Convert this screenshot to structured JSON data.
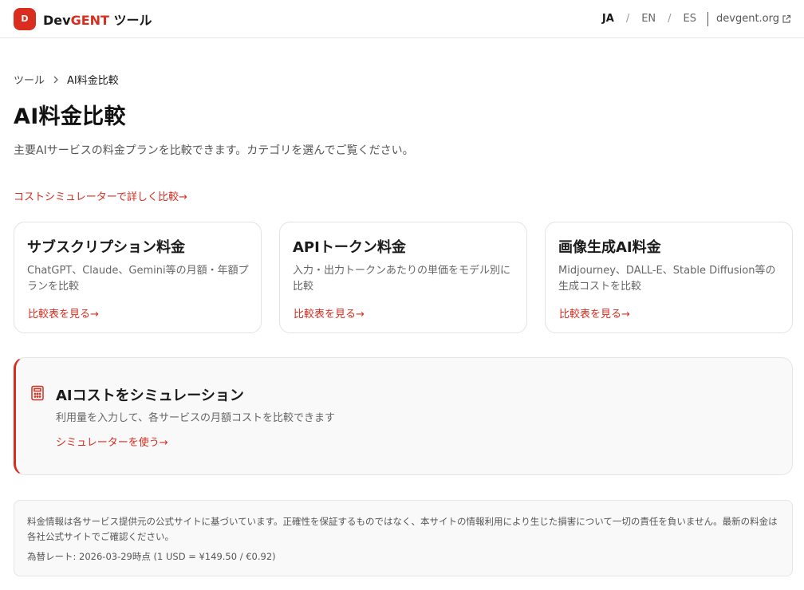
{
  "header": {
    "logo_letter": "D",
    "brand_prefix": "Dev",
    "brand_accent": "GENT",
    "brand_suffix": " ツール",
    "langs": [
      "JA",
      "EN",
      "ES"
    ],
    "active_lang": "JA",
    "site_link": "devgent.org",
    "site_link_icon": "external-link-icon"
  },
  "breadcrumb": {
    "root": "ツール",
    "separator_icon": "chevron-right-icon",
    "current": "AI料金比較"
  },
  "page": {
    "title": "AI料金比較",
    "description": "主要AIサービスの料金プランを比較できます。カテゴリを選んでご覧ください。",
    "simulator_link": "コストシミュレーターで詳しく比較→"
  },
  "cards": [
    {
      "title": "サブスクリプション料金",
      "desc": "ChatGPT、Claude、Gemini等の月額・年額プランを比較",
      "link": "比較表を見る→"
    },
    {
      "title": "APIトークン料金",
      "desc": "入力・出力トークンあたりの単価をモデル別に比較",
      "link": "比較表を見る→"
    },
    {
      "title": "画像生成AI料金",
      "desc": "Midjourney、DALL-E、Stable Diffusion等の生成コストを比較",
      "link": "比較表を見る→"
    }
  ],
  "simulator": {
    "icon": "calculator-icon",
    "title": "AIコストをシミュレーション",
    "desc": "利用量を入力して、各サービスの月額コストを比較できます",
    "cta": "シミュレーターを使う→"
  },
  "disclaimer": {
    "text": "料金情報は各サービス提供元の公式サイトに基づいています。正確性を保証するものではなく、本サイトの情報利用により生じた損害について一切の責任を負いません。最新の料金は各社公式サイトでご確認ください。",
    "rate": "為替レート: 2026-03-29時点 (1 USD = ¥149.50 / €0.92)"
  },
  "colors": {
    "accent": "#d92d20",
    "panel_bg": "#f9f9f9",
    "border": "#e5e5e5"
  }
}
